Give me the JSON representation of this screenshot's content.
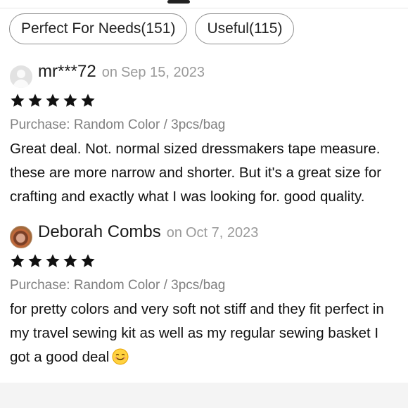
{
  "filters": [
    {
      "label": "Perfect For Needs",
      "count": "151"
    },
    {
      "label": "Useful",
      "count": "115"
    }
  ],
  "reviews": [
    {
      "author": "mr***72",
      "date_prefix": "on",
      "date": "Sep 15, 2023",
      "rating": 5,
      "avatar": "default-avatar-icon",
      "purchase": "Purchase: Random Color / 3pcs/bag",
      "text": "Great deal. Not. normal sized dressmakers tape measure. these are more narrow and shorter. But it's a great size for crafting and exactly what I was looking for. good quality."
    },
    {
      "author": "Deborah Combs",
      "date_prefix": "on",
      "date": "Oct 7, 2023",
      "rating": 5,
      "avatar": "user-photo",
      "purchase": "Purchase: Random Color / 3pcs/bag",
      "text": "for pretty colors and very soft not stiff and they fit perfect in my travel sewing kit as well as my regular sewing basket I got a good deal",
      "trailing_emoji": "smiling-face-emoji"
    }
  ],
  "colors": {
    "star": "#111111",
    "muted_text": "#7f7f7f",
    "date_text": "#9a9a9a",
    "chip_border": "#8f8f8f"
  }
}
